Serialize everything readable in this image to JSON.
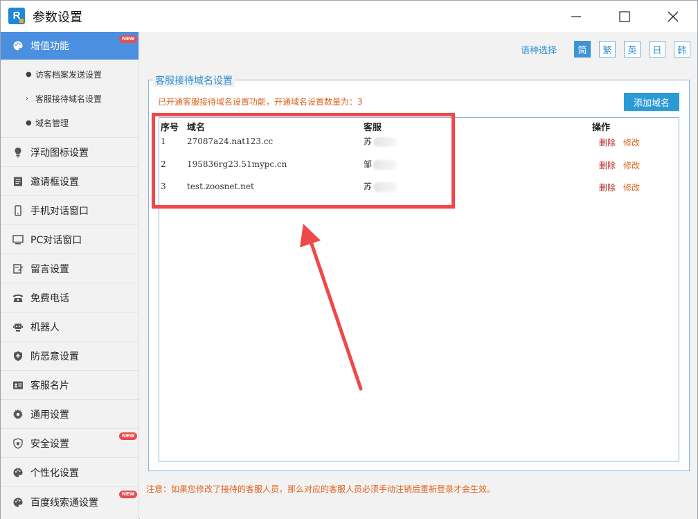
{
  "window": {
    "title": "参数设置",
    "controls": [
      "minimize",
      "maximize",
      "close"
    ]
  },
  "sidebar": {
    "items": [
      {
        "label": "增值功能",
        "icon": "palette-icon",
        "active": true,
        "badge": "NEW"
      },
      {
        "label": "浮动图标设置",
        "icon": "lightbulb-icon"
      },
      {
        "label": "邀请框设置",
        "icon": "document-icon"
      },
      {
        "label": "手机对话窗口",
        "icon": "mobile-icon"
      },
      {
        "label": "PC对话窗口",
        "icon": "monitor-icon"
      },
      {
        "label": "留言设置",
        "icon": "note-icon"
      },
      {
        "label": "免费电话",
        "icon": "phone-icon"
      },
      {
        "label": "机器人",
        "icon": "robot-icon"
      },
      {
        "label": "防恶意设置",
        "icon": "shield-plus-icon"
      },
      {
        "label": "客服名片",
        "icon": "id-card-icon"
      },
      {
        "label": "通用设置",
        "icon": "gear-icon"
      },
      {
        "label": "安全设置",
        "icon": "shield-icon",
        "badge": "NEW"
      },
      {
        "label": "个性化设置",
        "icon": "palette-icon"
      },
      {
        "label": "百度线索通设置",
        "icon": "palette-icon",
        "badge": "NEW"
      }
    ],
    "subitems": [
      {
        "label": "访客档案发送设置",
        "marker": "●"
      },
      {
        "label": "客服接待域名设置",
        "marker": "›"
      },
      {
        "label": "域名管理",
        "marker": "●"
      }
    ]
  },
  "language": {
    "label": "语种选择",
    "options": [
      "简",
      "繁",
      "英",
      "日",
      "韩"
    ],
    "selected": "简"
  },
  "panel": {
    "legend": "客服接待域名设置",
    "notice": "已开通客服接待域名设置功能，开通域名设置数量为：3",
    "add_button": "添加域名",
    "columns": {
      "index": "序号",
      "domain": "域名",
      "agent": "客服",
      "actions": "操作"
    },
    "rows": [
      {
        "index": "1",
        "domain": "27087a24.nat123.cc",
        "agent": "苏",
        "delete": "删除",
        "edit": "修改"
      },
      {
        "index": "2",
        "domain": "195836rg23.51mypc.cn",
        "agent": "邹",
        "delete": "删除",
        "edit": "修改"
      },
      {
        "index": "3",
        "domain": "test.zoosnet.net",
        "agent": "苏",
        "delete": "删除",
        "edit": "修改"
      }
    ]
  },
  "footnote": "注意：如果您修改了接待的客服人员，那么对应的客服人员必须手动注销后重新登录才会生效。",
  "colors": {
    "accent": "#4b8fe0",
    "notice": "#e0641e",
    "annotation": "#f04848"
  }
}
